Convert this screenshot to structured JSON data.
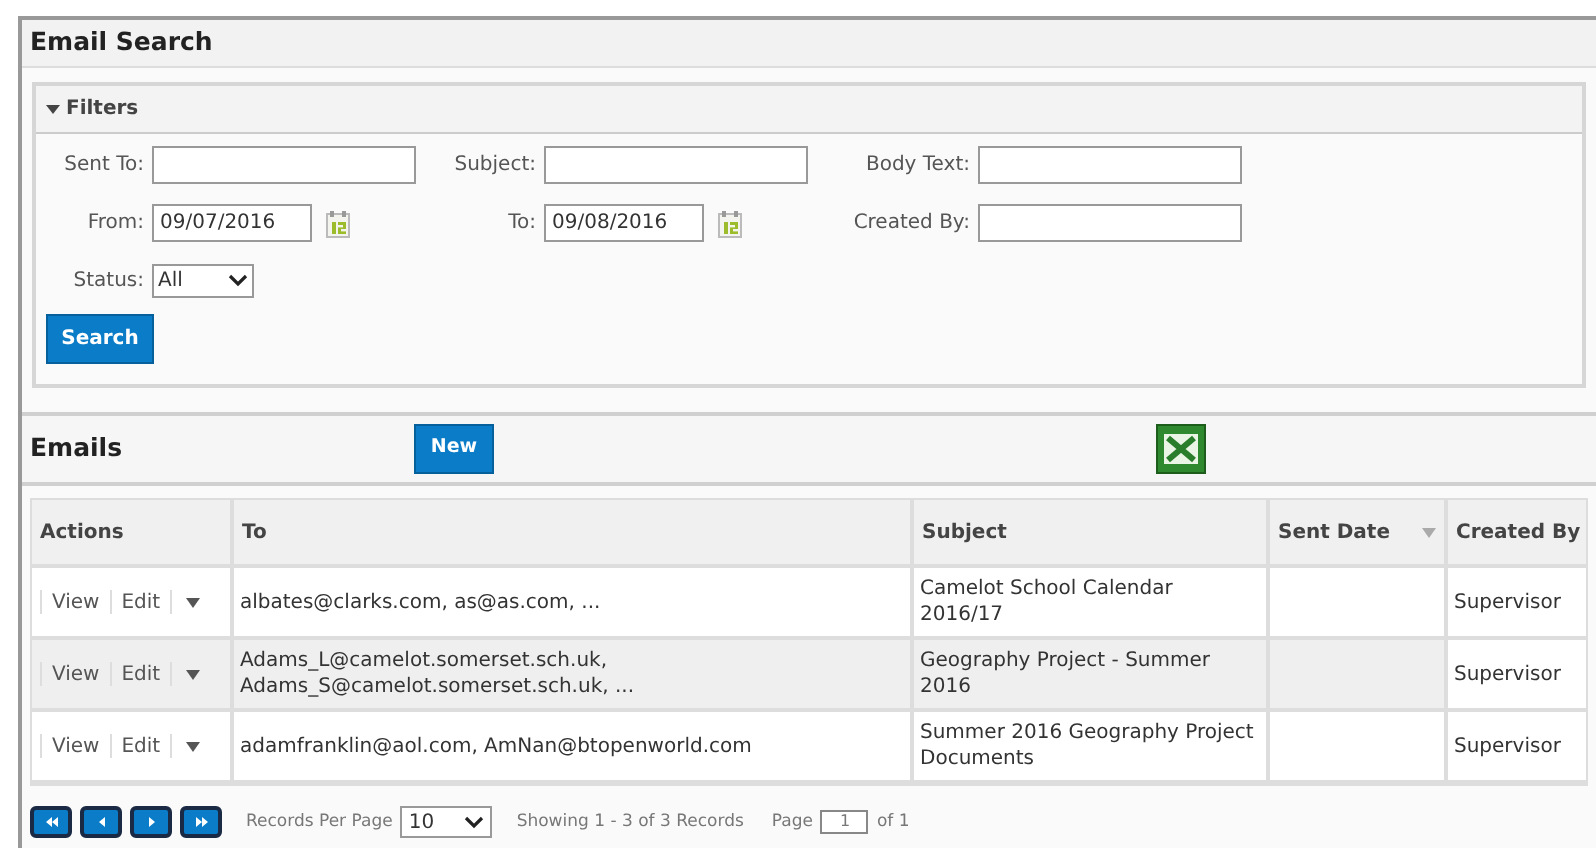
{
  "title": "Email Search",
  "filters": {
    "title": "Filters",
    "expanded": true,
    "fields": [
      {
        "label": "Sent To:",
        "kind": "text"
      },
      {
        "label": "Subject:",
        "kind": "text"
      },
      {
        "label": "Body Text:",
        "kind": "text"
      },
      {
        "label": "From:",
        "kind": "date",
        "value": "09/07/2016"
      },
      {
        "label": "To:",
        "kind": "date",
        "value": "09/08/2016"
      },
      {
        "label": "Created By:",
        "kind": "text"
      },
      {
        "label": "Status:",
        "kind": "select",
        "value": "All"
      }
    ],
    "search_button": "Search"
  },
  "emails": {
    "title": "Emails",
    "new_button": "New",
    "columns": [
      {
        "label": "Actions",
        "sorted": false
      },
      {
        "label": "To",
        "sorted": false
      },
      {
        "label": "Subject",
        "sorted": false
      },
      {
        "label": "Sent Date",
        "sorted": true
      },
      {
        "label": "Created By",
        "sorted": false
      }
    ],
    "rows": [
      {
        "actions": [
          "View",
          "Edit"
        ],
        "to": [
          "albates@clarks.com, as@as.com, ..."
        ],
        "subject": "Camelot School Calendar 2016/17",
        "created_by": "Supervisor"
      },
      {
        "actions": [
          "View",
          "Edit"
        ],
        "to": [
          "Adams_L@camelot.somerset.sch.uk,",
          "Adams_S@camelot.somerset.sch.uk, ..."
        ],
        "subject": "Geography Project - Summer 2016",
        "created_by": "Supervisor"
      },
      {
        "actions": [
          "View",
          "Edit"
        ],
        "to": [
          "adamfranklin@aol.com, AmNan@btopenworld.com"
        ],
        "subject": "Summer 2016 Geography Project Documents",
        "created_by": "Supervisor"
      }
    ]
  },
  "pagination": {
    "per_page_label": "Records Per Page",
    "per_page": "10",
    "showing": "Showing 1 - 3 of 3 Records",
    "page_label": "Page",
    "page": "1",
    "page_of": "of 1"
  }
}
